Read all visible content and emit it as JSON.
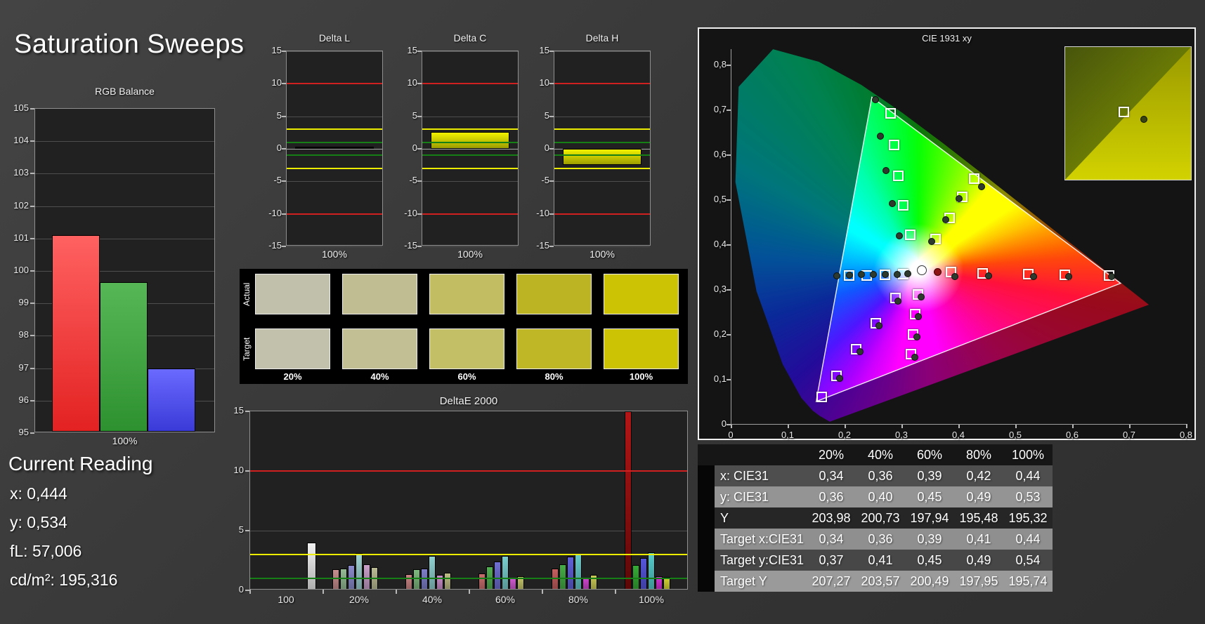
{
  "page": {
    "title": "Saturation Sweeps"
  },
  "rgb_balance": {
    "title": "RGB Balance",
    "xlabel": "100%",
    "chart_data": {
      "type": "bar",
      "categories": [
        "Red",
        "Green",
        "Blue"
      ],
      "values": [
        101.05,
        99.6,
        96.95
      ],
      "colors": [
        "#ef2b2b",
        "#2f9232",
        "#3c3cdc"
      ],
      "ylim": [
        95,
        105
      ],
      "yticks": [
        105,
        104,
        103,
        102,
        101,
        100,
        99,
        98,
        97,
        96,
        95
      ]
    }
  },
  "delta_charts": {
    "ylim": [
      -15,
      15
    ],
    "yticks": [
      15,
      10,
      5,
      0,
      -5,
      -10,
      -15
    ],
    "limit_lines": {
      "red": 10,
      "yellow": 3,
      "green": 1
    },
    "xlabel": "100%",
    "charts": [
      {
        "title": "Delta L",
        "value": 0.3,
        "color": "#0a0a0a",
        "style": "black"
      },
      {
        "title": "Delta C",
        "value": 2.6,
        "color": "#d8d800",
        "style": "yellow"
      },
      {
        "title": "Delta H",
        "value": -2.5,
        "color": "#d8d800",
        "style": "yellow"
      }
    ]
  },
  "swatches": {
    "row_labels": [
      "Actual",
      "Target"
    ],
    "col_labels": [
      "20%",
      "40%",
      "60%",
      "80%",
      "100%"
    ],
    "actual_colors": [
      "#c1c0aa",
      "#c1bd92",
      "#c2bd62",
      "#bdb424",
      "#cbc303"
    ],
    "target_colors": [
      "#c2c1ab",
      "#c2bf94",
      "#c3bf66",
      "#c0b726",
      "#cbc303"
    ]
  },
  "deltae": {
    "title": "DeltaE 2000",
    "ylim": [
      0,
      15
    ],
    "yticks": [
      15,
      10,
      5,
      0
    ],
    "limit_lines": {
      "red": 10,
      "yellow": 3,
      "green": 1
    },
    "chart_data": {
      "type": "bar",
      "groups": [
        {
          "label": "100",
          "offset": 36,
          "bars": [
            {
              "v": 4.0,
              "c": "#f2f2f2"
            }
          ]
        },
        {
          "label": "20%",
          "offset": -6,
          "bars": [
            {
              "v": 1.75,
              "c": "#c68f8f"
            },
            {
              "v": 1.85,
              "c": "#94bb94"
            },
            {
              "v": 2.1,
              "c": "#8b8bcb"
            },
            {
              "v": 3.1,
              "c": "#9fd3d3"
            },
            {
              "v": 2.2,
              "c": "#c9a0c9"
            },
            {
              "v": 1.95,
              "c": "#bcbc94"
            }
          ]
        },
        {
          "label": "40%",
          "offset": -6,
          "bars": [
            {
              "v": 1.35,
              "c": "#c98585"
            },
            {
              "v": 1.75,
              "c": "#7fba7f"
            },
            {
              "v": 1.85,
              "c": "#7f7fc9"
            },
            {
              "v": 2.9,
              "c": "#8fd0d0"
            },
            {
              "v": 1.3,
              "c": "#c98fc9"
            },
            {
              "v": 1.5,
              "c": "#bdbd85"
            }
          ]
        },
        {
          "label": "60%",
          "offset": -6,
          "bars": [
            {
              "v": 1.4,
              "c": "#c66e6e"
            },
            {
              "v": 2.0,
              "c": "#52b052"
            },
            {
              "v": 2.4,
              "c": "#6f6fd2"
            },
            {
              "v": 2.9,
              "c": "#79cfcf"
            },
            {
              "v": 1.0,
              "c": "#cb59cb"
            },
            {
              "v": 1.15,
              "c": "#c4c46a"
            }
          ]
        },
        {
          "label": "80%",
          "offset": -6,
          "bars": [
            {
              "v": 1.8,
              "c": "#c45f5f"
            },
            {
              "v": 2.2,
              "c": "#45ad45"
            },
            {
              "v": 2.85,
              "c": "#6161d8"
            },
            {
              "v": 3.05,
              "c": "#66cccc"
            },
            {
              "v": 1.05,
              "c": "#cc46cc"
            },
            {
              "v": 1.3,
              "c": "#caca55"
            }
          ]
        },
        {
          "label": "100%",
          "offset": -6,
          "bars": [
            {
              "v": 15.5,
              "c": "#8e1313",
              "clip": true
            },
            {
              "v": 2.1,
              "c": "#35ab35"
            },
            {
              "v": 2.7,
              "c": "#5656dd"
            },
            {
              "v": 3.2,
              "c": "#55cccc"
            },
            {
              "v": 1.2,
              "c": "#d332d3"
            },
            {
              "v": 1.1,
              "c": "#d3d332"
            }
          ]
        }
      ]
    }
  },
  "cie": {
    "title": "CIE 1931 xy",
    "x_ticks": [
      "0",
      "0,1",
      "0,2",
      "0,3",
      "0,4",
      "0,5",
      "0,6",
      "0,7",
      "0,8"
    ],
    "y_ticks": [
      "0",
      "0,1",
      "0,2",
      "0,3",
      "0,4",
      "0,5",
      "0,6",
      "0,7",
      "0,8"
    ],
    "gamut_triangle": [
      [
        0.685,
        0.313
      ],
      [
        0.248,
        0.727
      ],
      [
        0.15,
        0.05
      ]
    ],
    "target_squares": [
      [
        0.313,
        0.425
      ],
      [
        0.3,
        0.49
      ],
      [
        0.292,
        0.555
      ],
      [
        0.285,
        0.625
      ],
      [
        0.278,
        0.695
      ],
      [
        0.358,
        0.415
      ],
      [
        0.382,
        0.462
      ],
      [
        0.404,
        0.508
      ],
      [
        0.425,
        0.55
      ],
      [
        0.385,
        0.341
      ],
      [
        0.44,
        0.339
      ],
      [
        0.52,
        0.337
      ],
      [
        0.585,
        0.335
      ],
      [
        0.662,
        0.334
      ],
      [
        0.3,
        0.336
      ],
      [
        0.268,
        0.335
      ],
      [
        0.236,
        0.334
      ],
      [
        0.205,
        0.333
      ],
      [
        0.327,
        0.292
      ],
      [
        0.322,
        0.247
      ],
      [
        0.318,
        0.203
      ],
      [
        0.314,
        0.158
      ],
      [
        0.287,
        0.283
      ],
      [
        0.252,
        0.228
      ],
      [
        0.218,
        0.17
      ],
      [
        0.183,
        0.11
      ],
      [
        0.158,
        0.063
      ]
    ],
    "measured_dots": [
      [
        0.253,
        0.724
      ],
      [
        0.262,
        0.642
      ],
      [
        0.272,
        0.565
      ],
      [
        0.283,
        0.492
      ],
      [
        0.295,
        0.42
      ],
      [
        0.352,
        0.408
      ],
      [
        0.377,
        0.456
      ],
      [
        0.4,
        0.503
      ],
      [
        0.44,
        0.53
      ],
      [
        0.392,
        0.33
      ],
      [
        0.452,
        0.332
      ],
      [
        0.531,
        0.33
      ],
      [
        0.593,
        0.33
      ],
      [
        0.668,
        0.33
      ],
      [
        0.185,
        0.332
      ],
      [
        0.207,
        0.333
      ],
      [
        0.228,
        0.334
      ],
      [
        0.249,
        0.334
      ],
      [
        0.27,
        0.335
      ],
      [
        0.291,
        0.335
      ],
      [
        0.31,
        0.336
      ],
      [
        0.333,
        0.285
      ],
      [
        0.329,
        0.24
      ],
      [
        0.326,
        0.196
      ],
      [
        0.322,
        0.15
      ],
      [
        0.293,
        0.275
      ],
      [
        0.259,
        0.22
      ],
      [
        0.226,
        0.162
      ],
      [
        0.19,
        0.103
      ]
    ],
    "white_point": [
      0.334,
      0.344
    ],
    "current_point": [
      0.362,
      0.34
    ],
    "inset": {
      "square": [
        46,
        48
      ],
      "dot": [
        62,
        54
      ]
    }
  },
  "table": {
    "col_headers": [
      "20%",
      "40%",
      "60%",
      "80%",
      "100%"
    ],
    "rows": [
      {
        "label": "x: CIE31",
        "values": [
          "0,34",
          "0,36",
          "0,39",
          "0,42",
          "0,44"
        ],
        "bg": "#4e4e4e"
      },
      {
        "label": "y: CIE31",
        "values": [
          "0,36",
          "0,40",
          "0,45",
          "0,49",
          "0,53"
        ],
        "bg": "#949494"
      },
      {
        "label": "Y",
        "values": [
          "203,98",
          "200,73",
          "197,94",
          "195,48",
          "195,32"
        ],
        "bg": "#262626"
      },
      {
        "label": "Target x:CIE31",
        "values": [
          "0,34",
          "0,36",
          "0,39",
          "0,41",
          "0,44"
        ],
        "bg": "#8f8f8f"
      },
      {
        "label": "Target y:CIE31",
        "values": [
          "0,37",
          "0,41",
          "0,45",
          "0,49",
          "0,54"
        ],
        "bg": "#474747"
      },
      {
        "label": "Target Y",
        "values": [
          "207,27",
          "203,57",
          "200,49",
          "197,95",
          "195,74"
        ],
        "bg": "#9a9a9a"
      }
    ]
  },
  "current_reading": {
    "heading": "Current Reading",
    "lines": [
      "x: 0,444",
      "y: 0,534",
      "fL: 57,006",
      "cd/m²: 195,316"
    ]
  }
}
